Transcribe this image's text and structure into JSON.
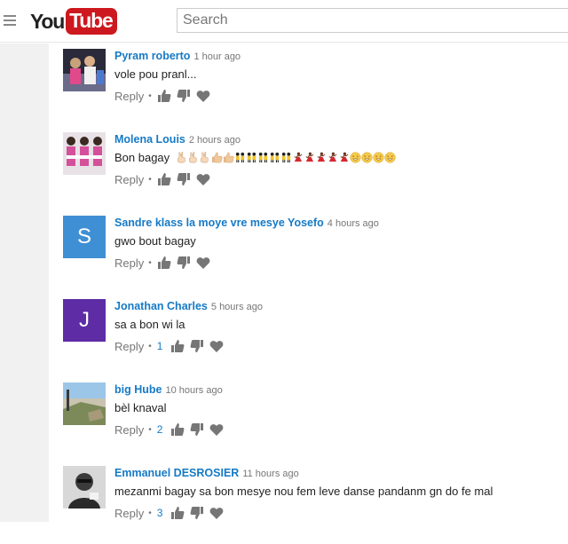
{
  "header": {
    "logo_you": "You",
    "logo_tube": "Tube",
    "search_placeholder": "Search"
  },
  "colors": {
    "brand_red": "#cc181e",
    "link_blue": "#167ac6",
    "meta_gray": "#767676"
  },
  "comments": [
    {
      "author": "Pyram roberto",
      "time": "1 hour ago",
      "text": "vole pou pranl...",
      "reply": "Reply",
      "likes": "",
      "avatar": "photo-group"
    },
    {
      "author": "Molena Louis",
      "time": "2 hours ago",
      "text": "Bon bagay",
      "reply": "Reply",
      "likes": "",
      "avatar": "photo-people"
    },
    {
      "author": "Sandre klass la moye vre mesye Yosefo",
      "time": "4 hours ago",
      "text": "gwo bout bagay",
      "reply": "Reply",
      "likes": "",
      "avatar": "letter",
      "avatar_letter": "S",
      "avatar_color": "#3f8fd4"
    },
    {
      "author": "Jonathan Charles",
      "time": "5 hours ago",
      "text": "sa a bon wi la",
      "reply": "Reply",
      "likes": "1",
      "avatar": "letter",
      "avatar_letter": "J",
      "avatar_color": "#5e2ca5"
    },
    {
      "author": "big Hube",
      "time": "10 hours ago",
      "text": "bèl knaval",
      "reply": "Reply",
      "likes": "2",
      "avatar": "photo-landscape"
    },
    {
      "author": "Emmanuel DESROSIER",
      "time": "11 hours ago",
      "text": "mezanmi bagay  sa bon mesye nou fem leve danse pandanm gn do fe mal",
      "reply": "Reply",
      "likes": "3",
      "avatar": "photo-portrait"
    }
  ],
  "emoji_row": {
    "icons": [
      "victory-hand-icon",
      "victory-hand-icon",
      "victory-hand-icon",
      "thumbs-up-icon",
      "thumbs-up-icon",
      "dancers-icon",
      "dancers-icon",
      "dancers-icon",
      "dancers-icon",
      "dancers-icon",
      "dancer-icon",
      "dancer-icon",
      "dancer-icon",
      "dancer-icon",
      "dancer-icon",
      "grin-icon",
      "grin-icon",
      "grin-icon",
      "grin-icon"
    ]
  },
  "action_separator": "•"
}
